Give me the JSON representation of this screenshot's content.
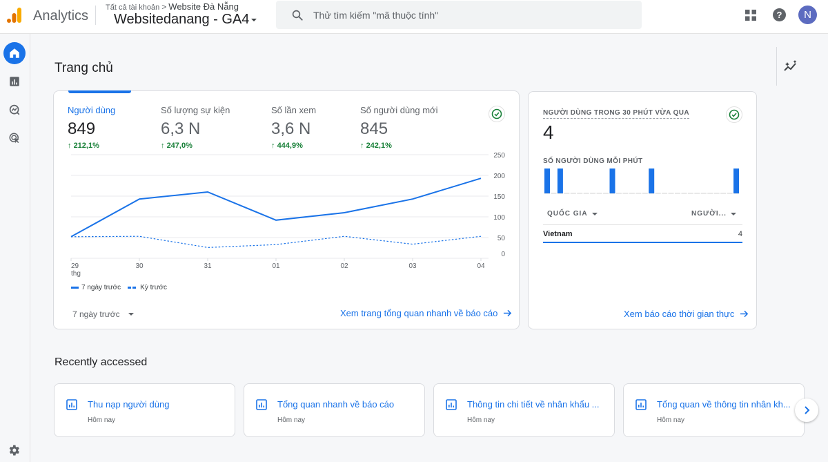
{
  "header": {
    "brand": "Analytics",
    "breadcrumb_root": "Tất cả tài khoản",
    "breadcrumb_sep": ">",
    "account": "Website Đà Nẵng",
    "property": "Websitedanang  - GA4",
    "search_placeholder": "Thử tìm kiếm \"mã thuộc tính\"",
    "avatar_initial": "N",
    "help_label": "?"
  },
  "page": {
    "title": "Trang chủ"
  },
  "overview": {
    "metrics": [
      {
        "label": "Người dùng",
        "value": "849",
        "change": "212,1%",
        "active": true
      },
      {
        "label": "Số lượng sự kiện",
        "value": "6,3 N",
        "change": "247,0%",
        "active": false
      },
      {
        "label": "Số lần xem",
        "value": "3,6 N",
        "change": "444,9%",
        "active": false
      },
      {
        "label": "Số người dùng mới",
        "value": "845",
        "change": "242,1%",
        "active": false
      }
    ],
    "range_label": "7 ngày trước",
    "link_label": "Xem trang tổng quan nhanh về báo cáo"
  },
  "chart_data": {
    "type": "line",
    "title": "",
    "xlabel": "",
    "ylabel": "",
    "x": [
      "29",
      "30",
      "31",
      "01",
      "02",
      "03",
      "04"
    ],
    "x_sublabel_first": "thg",
    "y_ticks": [
      0,
      50,
      100,
      150,
      200,
      250
    ],
    "ylim": [
      0,
      250
    ],
    "grid": true,
    "y_axis_side": "right",
    "legend_position": "bottom-left",
    "series": [
      {
        "name": "7 ngày trước",
        "style": "solid",
        "values": [
          52,
          143,
          160,
          92,
          110,
          143,
          193
        ]
      },
      {
        "name": "Kỳ trước",
        "style": "dashed",
        "values": [
          52,
          53,
          26,
          33,
          53,
          34,
          53
        ]
      }
    ]
  },
  "realtime": {
    "title": "NGƯỜI DÙNG TRONG 30 PHÚT VỪA QUA",
    "value": "4",
    "per_minute_label": "SỐ NGƯỜI DÙNG MỖI PHÚT",
    "per_minute": [
      1,
      0,
      1,
      0,
      0,
      0,
      0,
      0,
      0,
      0,
      1,
      0,
      0,
      0,
      0,
      0,
      1,
      0,
      0,
      0,
      0,
      0,
      0,
      0,
      0,
      0,
      0,
      0,
      0,
      1
    ],
    "col_country": "QUỐC GIA",
    "col_users": "NGƯỜI...",
    "rows": [
      {
        "country": "Vietnam",
        "users": "4"
      }
    ],
    "link_label": "Xem báo cáo thời gian thực"
  },
  "recent": {
    "title": "Recently accessed",
    "items": [
      {
        "title": "Thu nạp người dùng",
        "subtitle": "Hôm nay"
      },
      {
        "title": "Tổng quan nhanh về báo cáo",
        "subtitle": "Hôm nay"
      },
      {
        "title": "Thông tin chi tiết về nhân khẩu ...",
        "subtitle": "Hôm nay"
      },
      {
        "title": "Tổng quan về thông tin nhân kh...",
        "subtitle": "Hôm nay"
      }
    ]
  },
  "colors": {
    "accent": "#1a73e8",
    "positive": "#188038",
    "logo_orange": "#f9ab00",
    "logo_dark_orange": "#e37400",
    "avatar": "#5c6bc0"
  }
}
